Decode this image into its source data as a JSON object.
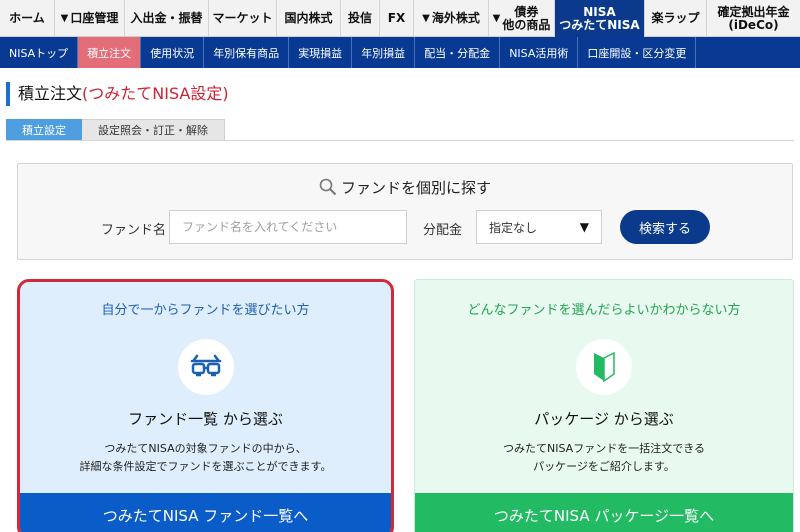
{
  "topnav": {
    "items": [
      {
        "label": "ホーム",
        "has_dropdown": false
      },
      {
        "label": "口座管理",
        "has_dropdown": true
      },
      {
        "label": "入出金・振替",
        "has_dropdown": false
      },
      {
        "label": "マーケット",
        "has_dropdown": false
      },
      {
        "label": "国内株式",
        "has_dropdown": false
      },
      {
        "label": "投信",
        "has_dropdown": false
      },
      {
        "label": "FX",
        "has_dropdown": false
      },
      {
        "label": "海外株式",
        "has_dropdown": true
      },
      {
        "label_line1": "債券",
        "label_line2": "他の商品",
        "has_dropdown": true
      },
      {
        "label_line1": "NISA",
        "label_line2": "つみたてNISA",
        "has_dropdown": false
      },
      {
        "label": "楽ラップ",
        "has_dropdown": false
      },
      {
        "label_line1": "確定拠出年金",
        "label_line2": "(iDeCo)",
        "has_dropdown": false
      }
    ]
  },
  "subnav": {
    "items": [
      "NISAトップ",
      "積立注文",
      "使用状況",
      "年別保有商品",
      "実現損益",
      "年別損益",
      "配当・分配金",
      "NISA活用術",
      "口座開設・区分変更"
    ]
  },
  "page": {
    "title_main": "積立注文",
    "title_sub": "(つみたてNISA設定)"
  },
  "tabs": [
    "積立設定",
    "設定照会・訂正・解除"
  ],
  "search": {
    "title": "ファンドを個別に探す",
    "fund_label": "ファンド名",
    "fund_placeholder": "ファンド名を入れてください",
    "dist_label": "分配金",
    "dist_selected": "指定なし",
    "button": "検索する"
  },
  "cards": {
    "left": {
      "subtitle": "自分で一からファンドを選びたい方",
      "heading": "ファンド一覧 から選ぶ",
      "desc_line1": "つみたてNISAの対象ファンドの中から、",
      "desc_line2": "詳細な条件設定でファンドを選ぶことができます。",
      "button": "つみたてNISA ファンド一覧へ",
      "icon": "glasses-icon"
    },
    "right": {
      "subtitle": "どんなファンドを選んだらよいかわからない方",
      "heading": "パッケージ から選ぶ",
      "desc_line1": "つみたてNISAファンドを一括注文できる",
      "desc_line2": "パッケージをご紹介します。",
      "button": "つみたてNISA パッケージ一覧へ",
      "icon": "beginner-mark-icon"
    }
  },
  "colors": {
    "nav_blue": "#0b3a8c",
    "subnav_active": "#e46d7a",
    "left_card_border": "#d2283a",
    "left_button": "#0a5cc8",
    "right_button": "#22ba62",
    "beginner_green": "#22ba62"
  }
}
